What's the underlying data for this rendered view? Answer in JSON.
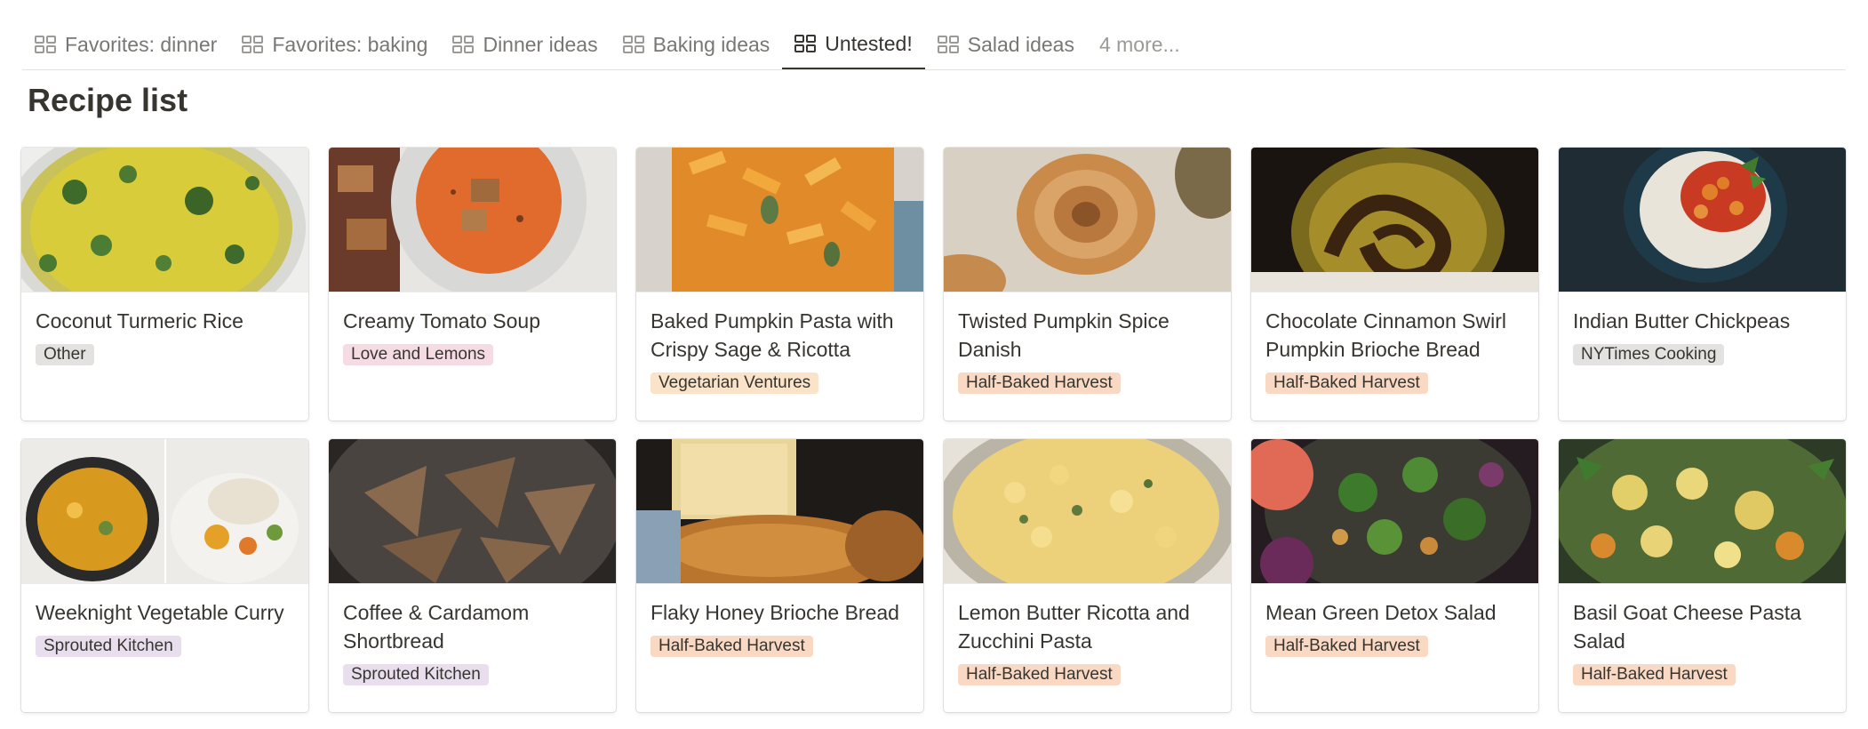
{
  "tabs": [
    {
      "label": "Favorites: dinner",
      "icon": "gallery-icon"
    },
    {
      "label": "Favorites: baking",
      "icon": "gallery-icon"
    },
    {
      "label": "Dinner ideas",
      "icon": "gallery-icon"
    },
    {
      "label": "Baking ideas",
      "icon": "gallery-icon"
    },
    {
      "label": "Untested!",
      "icon": "gallery-icon",
      "active": true
    },
    {
      "label": "Salad ideas",
      "icon": "gallery-icon"
    }
  ],
  "more_tabs_label": "4 more...",
  "page_title": "Recipe list",
  "tag_colors": {
    "Other": "#e3e2e0",
    "Love and Lemons": "#f5dce4",
    "Vegetarian Ventures": "#fae3c8",
    "Half-Baked Harvest": "#f9d9c4",
    "NYTimes Cooking": "#e3e2e0",
    "Sprouted Kitchen": "#e8deee"
  },
  "cards": [
    {
      "title": "Coconut Turmeric Rice",
      "tag": "Other",
      "image": "turmeric-rice-photo"
    },
    {
      "title": "Creamy Tomato Soup",
      "tag": "Love and Lemons",
      "image": "tomato-soup-photo"
    },
    {
      "title": "Baked Pumpkin Pasta with Crispy Sage & Ricotta",
      "tag": "Vegetarian Ventures",
      "image": "pumpkin-pasta-photo"
    },
    {
      "title": "Twisted Pumpkin Spice Danish",
      "tag": "Half-Baked Harvest",
      "image": "pumpkin-danish-photo"
    },
    {
      "title": "Chocolate Cinnamon Swirl Pumpkin Brioche Bread",
      "tag": "Half-Baked Harvest",
      "image": "brioche-bread-photo"
    },
    {
      "title": "Indian Butter Chickpeas",
      "tag": "NYTimes Cooking",
      "image": "butter-chickpeas-photo"
    },
    {
      "title": "Weeknight Vegetable Curry",
      "tag": "Sprouted Kitchen",
      "image": "vegetable-curry-photo"
    },
    {
      "title": "Coffee & Cardamom Shortbread",
      "tag": "Sprouted Kitchen",
      "image": "shortbread-photo"
    },
    {
      "title": "Flaky Honey Brioche Bread",
      "tag": "Half-Baked Harvest",
      "image": "honey-brioche-photo"
    },
    {
      "title": "Lemon Butter Ricotta and Zucchini Pasta",
      "tag": "Half-Baked Harvest",
      "image": "zucchini-pasta-photo"
    },
    {
      "title": "Mean Green Detox Salad",
      "tag": "Half-Baked Harvest",
      "image": "detox-salad-photo"
    },
    {
      "title": "Basil Goat Cheese Pasta Salad",
      "tag": "Half-Baked Harvest",
      "image": "pasta-salad-photo"
    }
  ]
}
